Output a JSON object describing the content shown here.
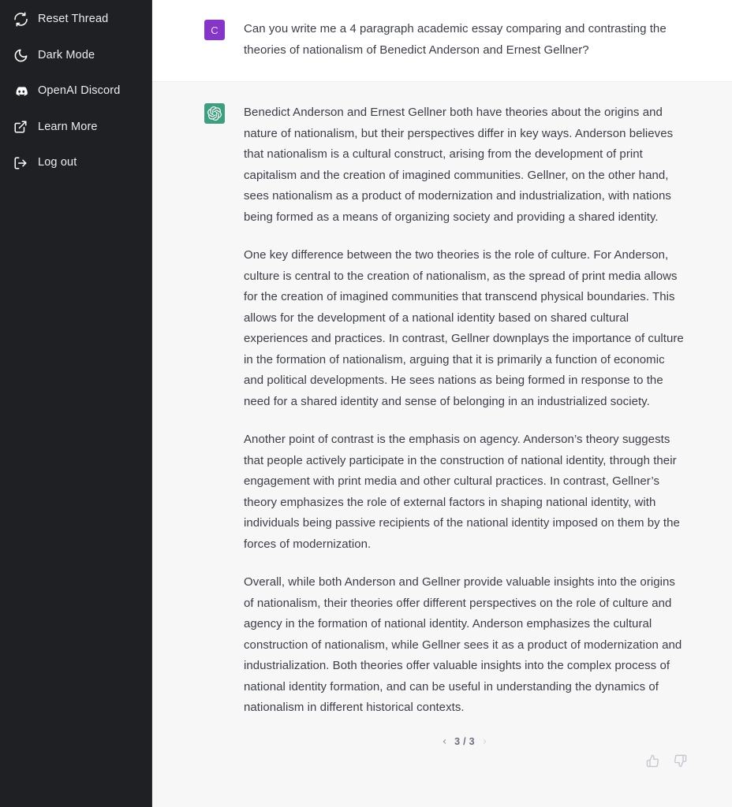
{
  "sidebar": {
    "items": [
      {
        "label": "Reset Thread",
        "icon": "reset-thread-icon",
        "name": "sidebar-item-reset-thread"
      },
      {
        "label": "Dark Mode",
        "icon": "moon-icon",
        "name": "sidebar-item-dark-mode"
      },
      {
        "label": "OpenAI Discord",
        "icon": "discord-icon",
        "name": "sidebar-item-openai-discord"
      },
      {
        "label": "Learn More",
        "icon": "external-link-icon",
        "name": "sidebar-item-learn-more"
      },
      {
        "label": "Log out",
        "icon": "logout-icon",
        "name": "sidebar-item-log-out"
      }
    ],
    "background_color": "#1f2023",
    "text_color": "#ececf1"
  },
  "conversation": {
    "user_message": {
      "avatar_initial": "C",
      "avatar_color": "#8536c9",
      "text": "Can you write me a 4 paragraph academic essay comparing and contrasting the theories of nationalism of Benedict Anderson and Ernest Gellner?"
    },
    "assistant_message": {
      "avatar_icon": "openai-logo-icon",
      "avatar_color": "#3f9e7f",
      "paragraphs": [
        "Benedict Anderson and Ernest Gellner both have theories about the origins and nature of nationalism, but their perspectives differ in key ways. Anderson believes that nationalism is a cultural construct, arising from the development of print capitalism and the creation of imagined communities. Gellner, on the other hand, sees nationalism as a product of modernization and industrialization, with nations being formed as a means of organizing society and providing a shared identity.",
        "One key difference between the two theories is the role of culture. For Anderson, culture is central to the creation of nationalism, as the spread of print media allows for the creation of imagined communities that transcend physical boundaries. This allows for the development of a national identity based on shared cultural experiences and practices. In contrast, Gellner downplays the importance of culture in the formation of nationalism, arguing that it is primarily a function of economic and political developments. He sees nations as being formed in response to the need for a shared identity and sense of belonging in an industrialized society.",
        "Another point of contrast is the emphasis on agency. Anderson’s theory suggests that people actively participate in the construction of national identity, through their engagement with print media and other cultural practices. In contrast, Gellner’s theory emphasizes the role of external factors in shaping national identity, with individuals being passive recipients of the national identity imposed on them by the forces of modernization.",
        "Overall, while both Anderson and Gellner provide valuable insights into the origins of nationalism, their theories offer different perspectives on the role of culture and agency in the formation of national identity. Anderson emphasizes the cultural construction of nationalism, while Gellner sees it as a product of modernization and industrialization. Both theories offer valuable insights into the complex process of national identity formation, and can be useful in understanding the dynamics of nationalism in different historical contexts."
      ]
    },
    "pagination": {
      "prev_icon": "chevron-left-icon",
      "next_icon": "chevron-right-icon",
      "count_label": "3 / 3",
      "current": 3,
      "total": 3
    },
    "feedback": {
      "thumbs_up_icon": "thumbs-up-icon",
      "thumbs_down_icon": "thumbs-down-icon"
    }
  }
}
